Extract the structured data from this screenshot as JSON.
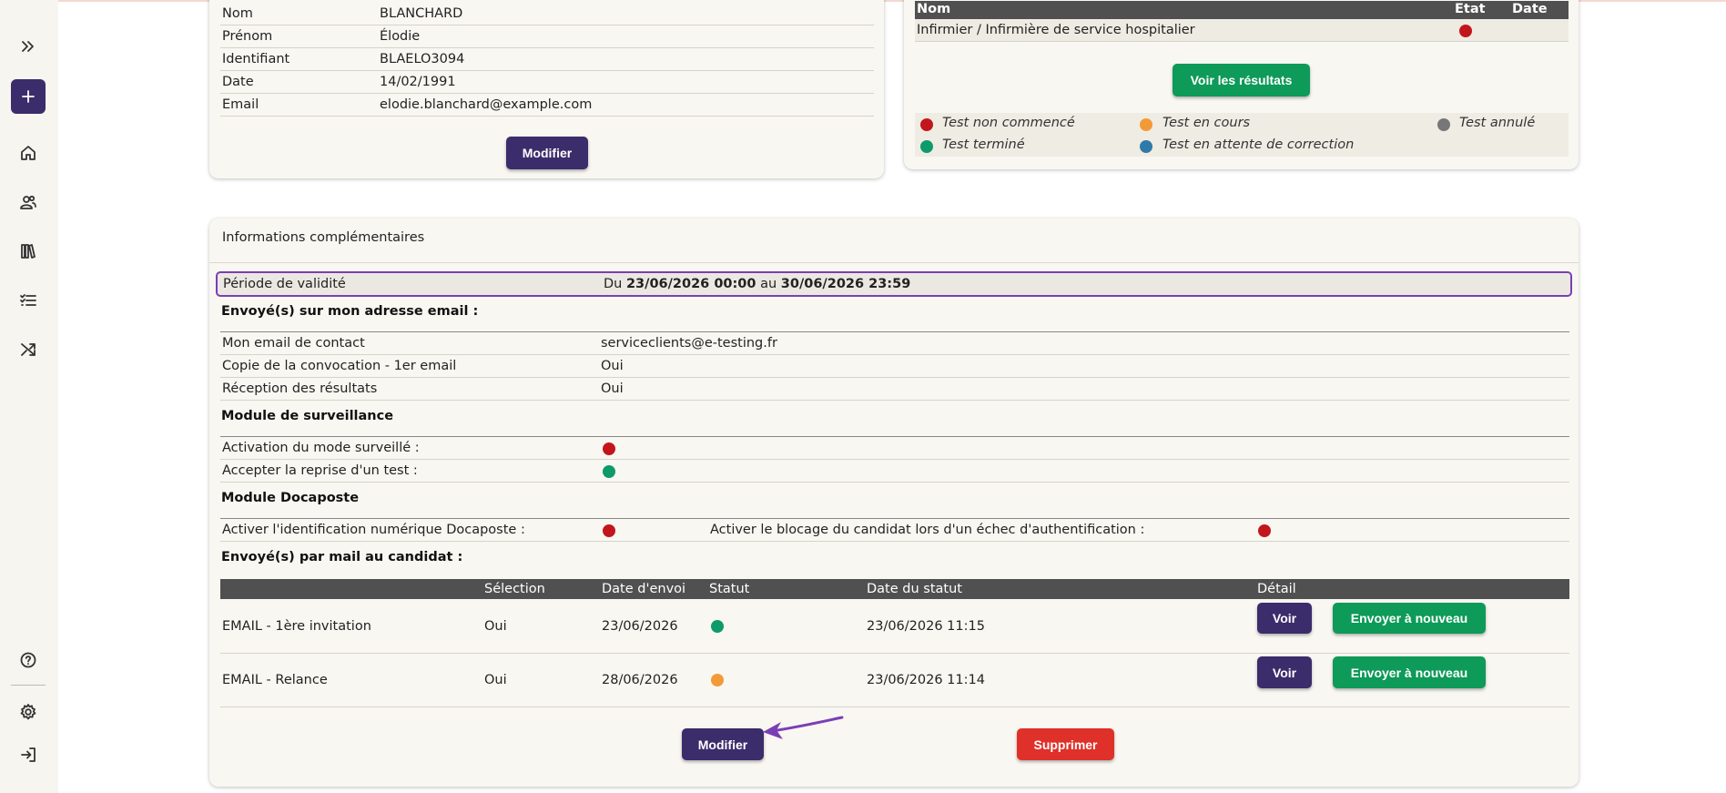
{
  "sidebar": {
    "items": [
      "expand-icon",
      "add-icon",
      "home-icon",
      "users-icon",
      "library-icon",
      "checklist-icon",
      "shuffle-icon",
      "help-icon",
      "settings-icon",
      "logout-icon"
    ]
  },
  "candidate": {
    "rows": [
      {
        "label": "Nom",
        "value": "BLANCHARD"
      },
      {
        "label": "Prénom",
        "value": "Élodie"
      },
      {
        "label": "Identifiant",
        "value": "BLAELO3094"
      },
      {
        "label": "Date",
        "value": "14/02/1991"
      },
      {
        "label": "Email",
        "value": "elodie.blanchard@example.com"
      }
    ],
    "modify_label": "Modifier"
  },
  "tests": {
    "headers": {
      "name": "Nom",
      "state": "Etat",
      "date": "Date"
    },
    "row": {
      "name": "Infirmier / Infirmière de service hospitalier",
      "state_color": "#c3161c",
      "date": ""
    },
    "results_button": "Voir les résultats",
    "legend": [
      {
        "label": "Test non commencé",
        "color": "#c3161c"
      },
      {
        "label": "Test en cours",
        "color": "#f39a38"
      },
      {
        "label": "Test annulé",
        "color": "#777777"
      },
      {
        "label": "Test terminé",
        "color": "#0e9a6a"
      },
      {
        "label": "Test en attente de correction",
        "color": "#2f7aa8"
      }
    ]
  },
  "info": {
    "title": "Informations complémentaires",
    "validity": {
      "label": "Période de validité",
      "du": "Du",
      "start": "23/06/2026 00:00",
      "au": "au",
      "end": "30/06/2026 23:59"
    },
    "sent_to_me": {
      "title": "Envoyé(s) sur mon adresse email :",
      "rows": [
        {
          "label": "Mon email de contact",
          "value": "serviceclients@e-testing.fr"
        },
        {
          "label": "Copie de la convocation - 1er email",
          "value": "Oui"
        },
        {
          "label": "Réception des résultats",
          "value": "Oui"
        }
      ]
    },
    "surveillance": {
      "title": "Module de surveillance",
      "rows": [
        {
          "label": "Activation du mode surveillé :",
          "color": "#c3161c"
        },
        {
          "label": "Accepter la reprise d'un test :",
          "color": "#0e9a6a"
        }
      ]
    },
    "docaposte": {
      "title": "Module Docaposte",
      "left_label": "Activer l'identification numérique Docaposte :",
      "left_color": "#c3161c",
      "right_label": "Activer le blocage du candidat lors d'un échec d'authentification :",
      "right_color": "#c3161c"
    },
    "mails": {
      "title": "Envoyé(s) par mail au candidat :",
      "headers": {
        "selection": "Sélection",
        "date_envoi": "Date d'envoi",
        "statut": "Statut",
        "date_statut": "Date du statut",
        "detail": "Détail"
      },
      "rows": [
        {
          "name": "EMAIL - 1ère invitation",
          "selection": "Oui",
          "date_envoi": "23/06/2026",
          "status_color": "#0e9a6a",
          "date_statut": "23/06/2026 11:15",
          "voir": "Voir",
          "resend": "Envoyer à nouveau"
        },
        {
          "name": "EMAIL - Relance",
          "selection": "Oui",
          "date_envoi": "28/06/2026",
          "status_color": "#f39a38",
          "date_statut": "23/06/2026 11:14",
          "voir": "Voir",
          "resend": "Envoyer à nouveau"
        }
      ]
    },
    "modify_label": "Modifier",
    "delete_label": "Supprimer"
  },
  "colors": {
    "primary": "#3b2c6b",
    "success": "#0e9a58",
    "danger": "#e0302a",
    "annotation": "#7a3fb5"
  }
}
